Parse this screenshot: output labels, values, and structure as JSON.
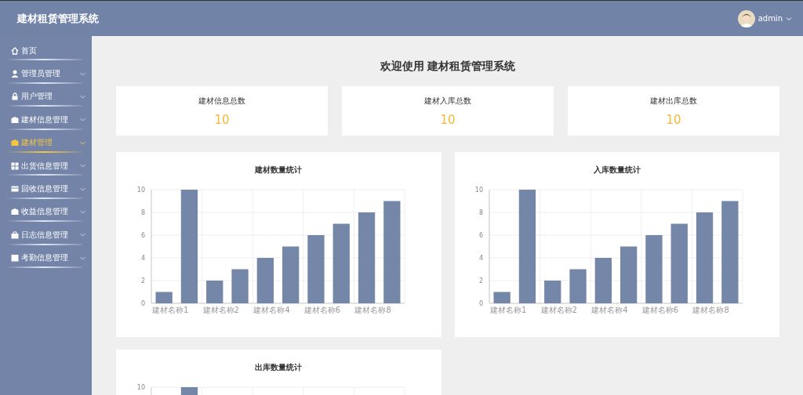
{
  "header": {
    "title": "建材租赁管理系统",
    "user": "admin"
  },
  "sidebar": {
    "items": [
      {
        "label": "首页",
        "expandable": false,
        "selected": false
      },
      {
        "label": "管理员管理",
        "expandable": true,
        "selected": false
      },
      {
        "label": "用户管理",
        "expandable": true,
        "selected": false
      },
      {
        "label": "建材信息管理",
        "expandable": true,
        "selected": false
      },
      {
        "label": "建材管理",
        "expandable": true,
        "selected": true
      },
      {
        "label": "出货信息管理",
        "expandable": true,
        "selected": false
      },
      {
        "label": "回收信息管理",
        "expandable": true,
        "selected": false
      },
      {
        "label": "收益信息管理",
        "expandable": true,
        "selected": false
      },
      {
        "label": "日志信息管理",
        "expandable": true,
        "selected": false
      },
      {
        "label": "考勤信息管理",
        "expandable": true,
        "selected": false
      }
    ]
  },
  "welcome": {
    "prefix": "欢迎使用",
    "system": "建材租赁管理系统"
  },
  "stats": [
    {
      "label": "建材信息总数",
      "value": "10"
    },
    {
      "label": "建材入库总数",
      "value": "10"
    },
    {
      "label": "建材出库总数",
      "value": "10"
    }
  ],
  "charts": [
    {
      "title": "建材数量统计",
      "chart_data": {
        "type": "bar",
        "categories": [
          "建材名称1",
          null,
          "建材名称2",
          null,
          "建材名称4",
          null,
          "建材名称6",
          null,
          "建材名称8",
          null
        ],
        "values": [
          1,
          10,
          2,
          3,
          4,
          5,
          6,
          7,
          8,
          9
        ],
        "ylim": [
          0,
          10
        ],
        "yticks": [
          0,
          2,
          4,
          6,
          8,
          10
        ],
        "grid": true
      }
    },
    {
      "title": "入库数量统计",
      "chart_data": {
        "type": "bar",
        "categories": [
          "建材名称1",
          null,
          "建材名称2",
          null,
          "建材名称4",
          null,
          "建材名称6",
          null,
          "建材名称8",
          null
        ],
        "values": [
          1,
          10,
          2,
          3,
          4,
          5,
          6,
          7,
          8,
          9
        ],
        "ylim": [
          0,
          10
        ],
        "yticks": [
          0,
          2,
          4,
          6,
          8,
          10
        ],
        "grid": true
      }
    },
    {
      "title": "出库数量统计",
      "axis_label": "10"
    }
  ]
}
